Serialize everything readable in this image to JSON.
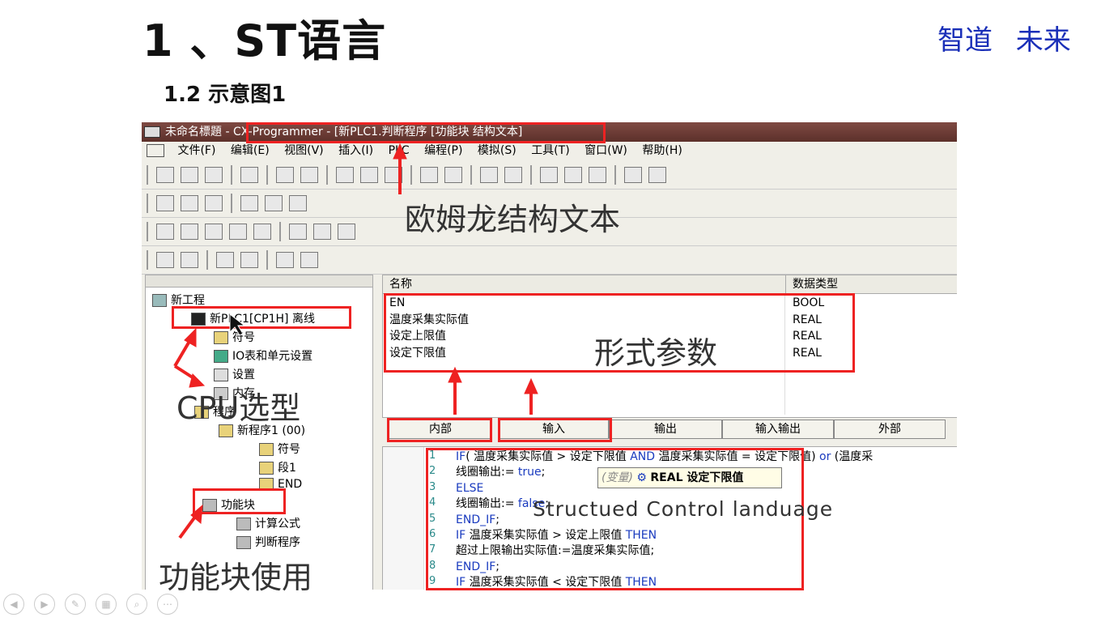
{
  "slide": {
    "title": "1 、ST语言",
    "brand": "智道   未来",
    "subtitle": "1.2 示意图1"
  },
  "window": {
    "title_prefix": "未命名標題 - ",
    "title_main": "CX-Programmer - [新PLC1.判断程序 [功能块 结构文本]"
  },
  "menu": [
    "文件(F)",
    "编辑(E)",
    "视图(V)",
    "插入(I)",
    "PLC",
    "编程(P)",
    "模拟(S)",
    "工具(T)",
    "窗口(W)",
    "帮助(H)"
  ],
  "tree": {
    "project": "新工程",
    "plc": "新PLC1[CP1H] 离线",
    "symbols": "符号",
    "io_table": "IO表和单元设置",
    "settings": "设置",
    "memory": "内存",
    "programs": "程序",
    "program1": "新程序1 (00)",
    "prog_symbols": "符号",
    "section1": "段1",
    "end": "END",
    "function_blocks": "功能块",
    "fb_calc": "计算公式",
    "fb_judge": "判断程序"
  },
  "params": {
    "col_name": "名称",
    "col_type": "数据类型",
    "rows": [
      {
        "name": "EN",
        "type": "BOOL"
      },
      {
        "name": "温度采集实际值",
        "type": "REAL"
      },
      {
        "name": "设定上限值",
        "type": "REAL"
      },
      {
        "name": "设定下限值",
        "type": "REAL"
      }
    ]
  },
  "tabs": [
    "内部",
    "输入",
    "输出",
    "输入输出",
    "外部"
  ],
  "code": {
    "lines": [
      {
        "n": "1",
        "parts": [
          {
            "t": "IF",
            "k": 1
          },
          {
            "t": "( 温度采集实际值  >  设定下限值 ",
            "k": 0
          },
          {
            "t": "AND",
            "k": 1
          },
          {
            "t": " 温度采集实际值 = 设定下限值) ",
            "k": 0
          },
          {
            "t": "or",
            "k": 1
          },
          {
            "t": "  (温度采",
            "k": 0
          }
        ]
      },
      {
        "n": "2",
        "parts": [
          {
            "t": "线圈输出:= ",
            "k": 0
          },
          {
            "t": "true",
            "k": 1
          },
          {
            "t": ";",
            "k": 0
          }
        ]
      },
      {
        "n": "3",
        "parts": [
          {
            "t": "ELSE",
            "k": 1
          }
        ]
      },
      {
        "n": "4",
        "parts": [
          {
            "t": "线圈输出:= ",
            "k": 0
          },
          {
            "t": "false",
            "k": 1
          },
          {
            "t": ";",
            "k": 0
          }
        ]
      },
      {
        "n": "5",
        "parts": [
          {
            "t": "END_IF",
            "k": 1
          },
          {
            "t": ";",
            "k": 0
          }
        ]
      },
      {
        "n": "6",
        "parts": [
          {
            "t": "IF",
            "k": 1
          },
          {
            "t": " 温度采集实际值 > 设定上限值 ",
            "k": 0
          },
          {
            "t": "THEN",
            "k": 1
          }
        ]
      },
      {
        "n": "7",
        "parts": [
          {
            "t": "   超过上限输出实际值:=温度采集实际值;",
            "k": 0
          }
        ]
      },
      {
        "n": "8",
        "parts": [
          {
            "t": "END_IF",
            "k": 1
          },
          {
            "t": ";",
            "k": 0
          }
        ]
      },
      {
        "n": "9",
        "parts": [
          {
            "t": "IF",
            "k": 1
          },
          {
            "t": " 温度采集实际值 < 设定下限值 ",
            "k": 0
          },
          {
            "t": "THEN",
            "k": 1
          }
        ]
      }
    ],
    "tooltip_kind": "(变量)",
    "tooltip_text": "REAL 设定下限值"
  },
  "annotations": {
    "omron_st": "欧姆龙结构文本",
    "formal_params": "形式参数",
    "cpu_select": "CPU选型",
    "fb_use": "功能块使用",
    "st_lang": "Structued Control landuage"
  },
  "colors": {
    "annotation_red": "#e22222",
    "brand_blue": "#1a2fb8",
    "keyword_blue": "#1a3bbf"
  }
}
